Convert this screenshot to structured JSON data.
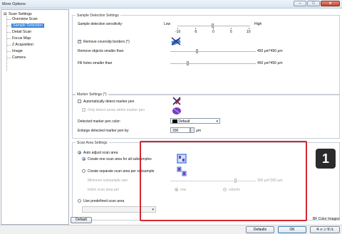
{
  "window": {
    "title": "More Options",
    "close_glyph": "x"
  },
  "tree": {
    "root": "Scan Settings",
    "items": [
      "Overview Scan",
      "Sample Detection",
      "Detail Scan",
      "Focus Map",
      "Z Acquisition",
      "Image",
      "Camera"
    ]
  },
  "sample_detection": {
    "title": "Sample Detection Settings",
    "sensitivity_label": "Sample detection sensitivity:",
    "low": "Low",
    "high": "High",
    "scale": [
      "-10",
      "-5",
      "0",
      "5",
      "10"
    ],
    "remove_overslip": "Remove coverslip borders (*)",
    "remove_smaller": "Remove objects smaller than",
    "remove_smaller_value": "450 μm*450 μm",
    "fill_holes": "Fill holes smaller than",
    "fill_holes_value": "450 μm*450 μm"
  },
  "marker": {
    "title": "Marker Settings (*)",
    "auto_detect": "Automatically detect marker pen",
    "only_within": "Only detect areas within marker pen",
    "color_label": "Detected marker pen color:",
    "color_value": "Default",
    "enlarge_label": "Enlarge detected marker pen by:",
    "enlarge_value": "200",
    "enlarge_unit": "μm"
  },
  "scan_area": {
    "title": "Scan Area Settings",
    "auto_adjust": "Auto adjust scan area",
    "create_one": "Create one scan area for all subsamples",
    "create_separate": "Create separate scan area per subsample",
    "min_size": "Minimum subsample size",
    "min_size_value": "300 μm*300 μm",
    "index_per": "Index scan area per",
    "row": "row",
    "column": "column",
    "use_predefined": "Use predefined scan area"
  },
  "footer": {
    "default_btn": "Default",
    "partial_label": "BF Color Images",
    "defaults_btn": "Defaults",
    "ok_btn": "OK",
    "cancel_btn": "キャンセル"
  },
  "annotation": {
    "badge": "1",
    "color": "#d62633"
  },
  "colors": {
    "selection": "#3a84d9",
    "accent": "#2a5fc2"
  }
}
